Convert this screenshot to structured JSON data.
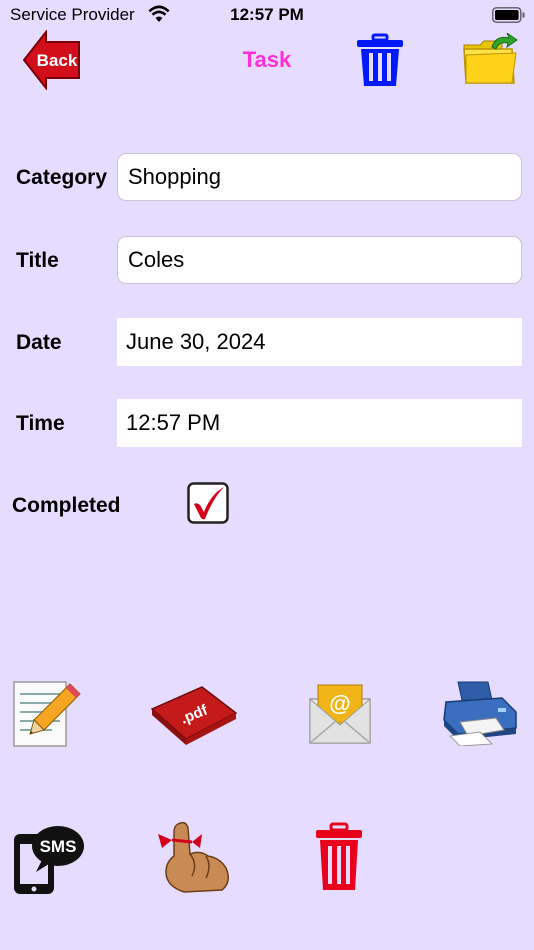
{
  "status_bar": {
    "carrier": "Service Provider",
    "time": "12:57 PM"
  },
  "nav": {
    "back_label": "Back",
    "title": "Task"
  },
  "form": {
    "category": {
      "label": "Category",
      "value": "Shopping"
    },
    "title": {
      "label": "Title",
      "value": "Coles"
    },
    "date": {
      "label": "Date",
      "value": "June 30, 2024"
    },
    "time": {
      "label": "Time",
      "value": "12:57 PM"
    },
    "completed": {
      "label": "Completed",
      "checked": true
    }
  },
  "actions": {
    "sms_label": "SMS",
    "pdf_label": ".pdf",
    "email_symbol": "@"
  },
  "colors": {
    "background": "#e6dcff",
    "title": "#ff2fd8",
    "trash_top": "#0019ff",
    "trash_bottom": "#e8001c",
    "back_arrow": "#d20e1b"
  },
  "icons": [
    "back-arrow-icon",
    "trash-icon",
    "folder-open-icon",
    "notepad-pencil-icon",
    "pdf-icon",
    "email-envelope-icon",
    "printer-icon",
    "sms-phone-icon",
    "finger-reminder-icon",
    "checkbox-icon"
  ]
}
